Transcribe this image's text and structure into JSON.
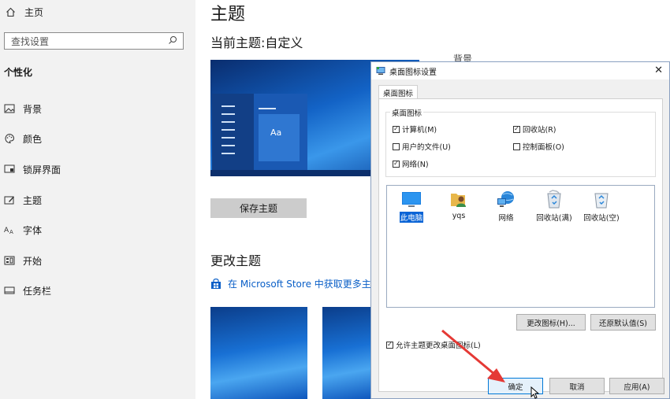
{
  "sidebar": {
    "home_label": "主页",
    "search_placeholder": "查找设置",
    "group_title": "个性化",
    "items": [
      {
        "label": "背景",
        "icon": "image-icon"
      },
      {
        "label": "颜色",
        "icon": "palette-icon"
      },
      {
        "label": "锁屏界面",
        "icon": "lock-screen-icon"
      },
      {
        "label": "主题",
        "icon": "theme-icon"
      },
      {
        "label": "字体",
        "icon": "font-icon"
      },
      {
        "label": "开始",
        "icon": "start-icon"
      },
      {
        "label": "任务栏",
        "icon": "taskbar-icon"
      }
    ]
  },
  "main": {
    "title": "主题",
    "current_theme": "当前主题:自定义",
    "preview_sample": "Aa",
    "save_button": "保存主题",
    "change_title": "更改主题",
    "store_link": "在 Microsoft Store 中获取更多主题",
    "behind_text": "背景"
  },
  "dialog": {
    "title": "桌面图标设置",
    "tab": "桌面图标",
    "group_label": "桌面图标",
    "checkboxes": [
      {
        "label": "计算机(M)",
        "checked": true
      },
      {
        "label": "回收站(R)",
        "checked": true
      },
      {
        "label": "用户的文件(U)",
        "checked": false
      },
      {
        "label": "控制面板(O)",
        "checked": false
      },
      {
        "label": "网络(N)",
        "checked": true
      }
    ],
    "icons": [
      {
        "label": "此电脑",
        "icon": "this-pc-icon",
        "selected": true
      },
      {
        "label": "yqs",
        "icon": "user-folder-icon",
        "selected": false
      },
      {
        "label": "网络",
        "icon": "network-icon",
        "selected": false
      },
      {
        "label": "回收站(满)",
        "icon": "recycle-bin-full-icon",
        "selected": false
      },
      {
        "label": "回收站(空)",
        "icon": "recycle-bin-empty-icon",
        "selected": false
      }
    ],
    "change_icon_button": "更改图标(H)...",
    "restore_default_button": "还原默认值(S)",
    "allow_themes_label": "允许主题更改桌面图标(L)",
    "allow_themes_checked": true,
    "ok_button": "确定",
    "cancel_button": "取消",
    "apply_button": "应用(A)"
  },
  "colors": {
    "sidebar_bg": "#f2f2f2",
    "accent": "#0078d7",
    "link": "#0a5fc7",
    "annotation_arrow": "#e53935"
  }
}
